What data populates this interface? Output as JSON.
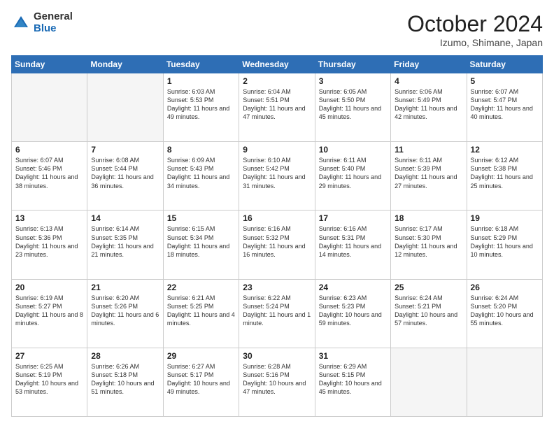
{
  "header": {
    "logo": {
      "general": "General",
      "blue": "Blue"
    },
    "title": "October 2024",
    "location": "Izumo, Shimane, Japan"
  },
  "weekdays": [
    "Sunday",
    "Monday",
    "Tuesday",
    "Wednesday",
    "Thursday",
    "Friday",
    "Saturday"
  ],
  "weeks": [
    [
      {
        "day": "",
        "empty": true
      },
      {
        "day": "",
        "empty": true
      },
      {
        "day": "1",
        "sunrise": "Sunrise: 6:03 AM",
        "sunset": "Sunset: 5:53 PM",
        "daylight": "Daylight: 11 hours and 49 minutes."
      },
      {
        "day": "2",
        "sunrise": "Sunrise: 6:04 AM",
        "sunset": "Sunset: 5:51 PM",
        "daylight": "Daylight: 11 hours and 47 minutes."
      },
      {
        "day": "3",
        "sunrise": "Sunrise: 6:05 AM",
        "sunset": "Sunset: 5:50 PM",
        "daylight": "Daylight: 11 hours and 45 minutes."
      },
      {
        "day": "4",
        "sunrise": "Sunrise: 6:06 AM",
        "sunset": "Sunset: 5:49 PM",
        "daylight": "Daylight: 11 hours and 42 minutes."
      },
      {
        "day": "5",
        "sunrise": "Sunrise: 6:07 AM",
        "sunset": "Sunset: 5:47 PM",
        "daylight": "Daylight: 11 hours and 40 minutes."
      }
    ],
    [
      {
        "day": "6",
        "sunrise": "Sunrise: 6:07 AM",
        "sunset": "Sunset: 5:46 PM",
        "daylight": "Daylight: 11 hours and 38 minutes."
      },
      {
        "day": "7",
        "sunrise": "Sunrise: 6:08 AM",
        "sunset": "Sunset: 5:44 PM",
        "daylight": "Daylight: 11 hours and 36 minutes."
      },
      {
        "day": "8",
        "sunrise": "Sunrise: 6:09 AM",
        "sunset": "Sunset: 5:43 PM",
        "daylight": "Daylight: 11 hours and 34 minutes."
      },
      {
        "day": "9",
        "sunrise": "Sunrise: 6:10 AM",
        "sunset": "Sunset: 5:42 PM",
        "daylight": "Daylight: 11 hours and 31 minutes."
      },
      {
        "day": "10",
        "sunrise": "Sunrise: 6:11 AM",
        "sunset": "Sunset: 5:40 PM",
        "daylight": "Daylight: 11 hours and 29 minutes."
      },
      {
        "day": "11",
        "sunrise": "Sunrise: 6:11 AM",
        "sunset": "Sunset: 5:39 PM",
        "daylight": "Daylight: 11 hours and 27 minutes."
      },
      {
        "day": "12",
        "sunrise": "Sunrise: 6:12 AM",
        "sunset": "Sunset: 5:38 PM",
        "daylight": "Daylight: 11 hours and 25 minutes."
      }
    ],
    [
      {
        "day": "13",
        "sunrise": "Sunrise: 6:13 AM",
        "sunset": "Sunset: 5:36 PM",
        "daylight": "Daylight: 11 hours and 23 minutes."
      },
      {
        "day": "14",
        "sunrise": "Sunrise: 6:14 AM",
        "sunset": "Sunset: 5:35 PM",
        "daylight": "Daylight: 11 hours and 21 minutes."
      },
      {
        "day": "15",
        "sunrise": "Sunrise: 6:15 AM",
        "sunset": "Sunset: 5:34 PM",
        "daylight": "Daylight: 11 hours and 18 minutes."
      },
      {
        "day": "16",
        "sunrise": "Sunrise: 6:16 AM",
        "sunset": "Sunset: 5:32 PM",
        "daylight": "Daylight: 11 hours and 16 minutes."
      },
      {
        "day": "17",
        "sunrise": "Sunrise: 6:16 AM",
        "sunset": "Sunset: 5:31 PM",
        "daylight": "Daylight: 11 hours and 14 minutes."
      },
      {
        "day": "18",
        "sunrise": "Sunrise: 6:17 AM",
        "sunset": "Sunset: 5:30 PM",
        "daylight": "Daylight: 11 hours and 12 minutes."
      },
      {
        "day": "19",
        "sunrise": "Sunrise: 6:18 AM",
        "sunset": "Sunset: 5:29 PM",
        "daylight": "Daylight: 11 hours and 10 minutes."
      }
    ],
    [
      {
        "day": "20",
        "sunrise": "Sunrise: 6:19 AM",
        "sunset": "Sunset: 5:27 PM",
        "daylight": "Daylight: 11 hours and 8 minutes."
      },
      {
        "day": "21",
        "sunrise": "Sunrise: 6:20 AM",
        "sunset": "Sunset: 5:26 PM",
        "daylight": "Daylight: 11 hours and 6 minutes."
      },
      {
        "day": "22",
        "sunrise": "Sunrise: 6:21 AM",
        "sunset": "Sunset: 5:25 PM",
        "daylight": "Daylight: 11 hours and 4 minutes."
      },
      {
        "day": "23",
        "sunrise": "Sunrise: 6:22 AM",
        "sunset": "Sunset: 5:24 PM",
        "daylight": "Daylight: 11 hours and 1 minute."
      },
      {
        "day": "24",
        "sunrise": "Sunrise: 6:23 AM",
        "sunset": "Sunset: 5:23 PM",
        "daylight": "Daylight: 10 hours and 59 minutes."
      },
      {
        "day": "25",
        "sunrise": "Sunrise: 6:24 AM",
        "sunset": "Sunset: 5:21 PM",
        "daylight": "Daylight: 10 hours and 57 minutes."
      },
      {
        "day": "26",
        "sunrise": "Sunrise: 6:24 AM",
        "sunset": "Sunset: 5:20 PM",
        "daylight": "Daylight: 10 hours and 55 minutes."
      }
    ],
    [
      {
        "day": "27",
        "sunrise": "Sunrise: 6:25 AM",
        "sunset": "Sunset: 5:19 PM",
        "daylight": "Daylight: 10 hours and 53 minutes."
      },
      {
        "day": "28",
        "sunrise": "Sunrise: 6:26 AM",
        "sunset": "Sunset: 5:18 PM",
        "daylight": "Daylight: 10 hours and 51 minutes."
      },
      {
        "day": "29",
        "sunrise": "Sunrise: 6:27 AM",
        "sunset": "Sunset: 5:17 PM",
        "daylight": "Daylight: 10 hours and 49 minutes."
      },
      {
        "day": "30",
        "sunrise": "Sunrise: 6:28 AM",
        "sunset": "Sunset: 5:16 PM",
        "daylight": "Daylight: 10 hours and 47 minutes."
      },
      {
        "day": "31",
        "sunrise": "Sunrise: 6:29 AM",
        "sunset": "Sunset: 5:15 PM",
        "daylight": "Daylight: 10 hours and 45 minutes."
      },
      {
        "day": "",
        "empty": true
      },
      {
        "day": "",
        "empty": true
      }
    ]
  ]
}
